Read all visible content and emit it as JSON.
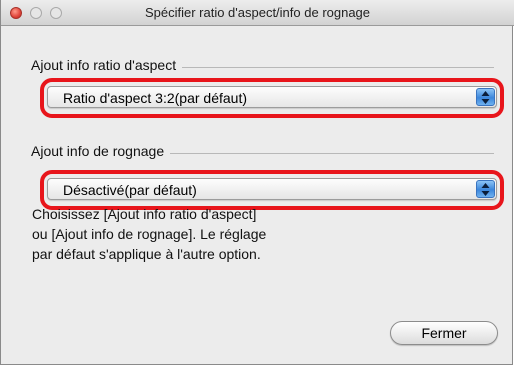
{
  "window": {
    "title": "Spécifier ratio d'aspect/info de rognage"
  },
  "aspect_group": {
    "label": "Ajout info ratio d'aspect",
    "selected": "Ratio d'aspect 3:2(par défaut)"
  },
  "crop_group": {
    "label": "Ajout info de rognage",
    "selected": "Désactivé(par défaut)"
  },
  "description": {
    "line1": "Choisissez [Ajout info ratio d'aspect]",
    "line2": "ou [Ajout info de rognage]. Le réglage",
    "line3": "par défaut s'applique à l'autre option."
  },
  "buttons": {
    "close_label": "Fermer"
  },
  "icons": {
    "popup_stepper": "up-down-arrows-icon"
  },
  "colors": {
    "highlight": "#e8151b",
    "stepper_blue": "#3b86db"
  }
}
